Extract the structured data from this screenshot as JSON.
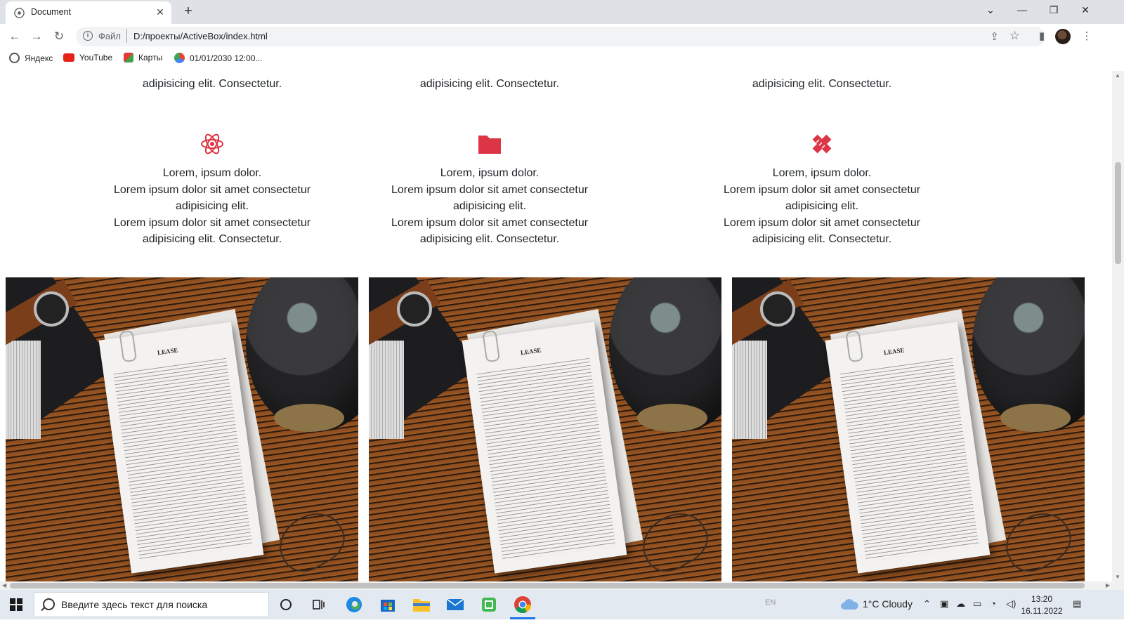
{
  "browser": {
    "tab_title": "Document",
    "url_scheme": "Файл",
    "url": "D:/проекты/ActiveBox/index.html",
    "bookmarks": [
      "Яндекс",
      "YouTube",
      "Карты",
      "01/01/2030 12:00..."
    ]
  },
  "page": {
    "top_partial_text": [
      "adipisicing elit. Consectetur.",
      "adipisicing elit. Consectetur.",
      "adipisicing elit. Consectetur."
    ],
    "features": [
      {
        "icon": "atom-icon",
        "title": "Lorem, ipsum dolor.",
        "line1": "Lorem ipsum dolor sit amet consectetur",
        "line2": "adipisicing elit.",
        "line3": "Lorem ipsum dolor sit amet consectetur",
        "line4": "adipisicing elit. Consectetur."
      },
      {
        "icon": "folder-icon",
        "title": "Lorem, ipsum dolor.",
        "line1": "Lorem ipsum dolor sit amet consectetur",
        "line2": "adipisicing elit.",
        "line3": "Lorem ipsum dolor sit amet consectetur",
        "line4": "adipisicing elit. Consectetur."
      },
      {
        "icon": "pencil-ruler-icon",
        "title": "Lorem, ipsum dolor.",
        "line1": "Lorem ipsum dolor sit amet consectetur",
        "line2": "adipisicing elit.",
        "line3": "Lorem ipsum dolor sit amet consectetur",
        "line4": "adipisicing elit. Consectetur."
      }
    ],
    "accent_color": "#dc3545",
    "photo_paper_title": "LEASE"
  },
  "taskbar": {
    "search_placeholder": "Введите здесь текст для поиска",
    "weather": "1°C  Cloudy",
    "lang": "EN",
    "time": "13:20",
    "date": "16.11.2022"
  }
}
